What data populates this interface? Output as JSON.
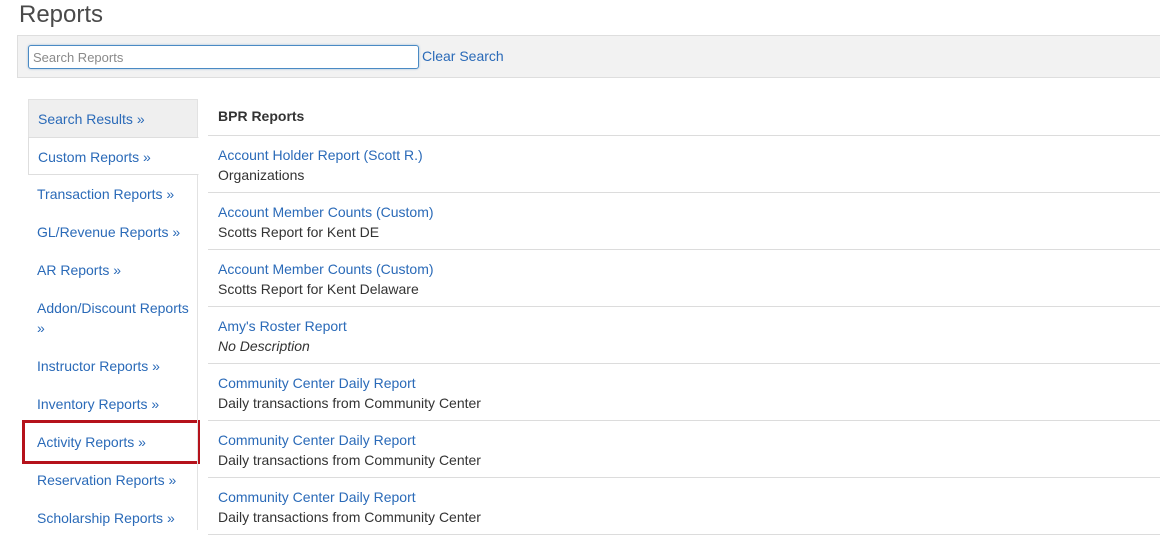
{
  "page": {
    "title": "Reports"
  },
  "search": {
    "placeholder": "Search Reports",
    "value": "",
    "clear_label": "Clear Search"
  },
  "sidebar": {
    "items": [
      {
        "label": "Search Results »"
      },
      {
        "label": "Custom Reports »"
      },
      {
        "label": "Transaction Reports »"
      },
      {
        "label": "GL/Revenue Reports »"
      },
      {
        "label": "AR Reports »"
      },
      {
        "label": "Addon/Discount Reports »"
      },
      {
        "label": "Instructor Reports »"
      },
      {
        "label": "Inventory Reports »"
      },
      {
        "label": "Activity Reports »"
      },
      {
        "label": "Reservation Reports »"
      },
      {
        "label": "Scholarship Reports »"
      }
    ]
  },
  "main": {
    "heading": "BPR Reports",
    "reports": [
      {
        "name": "Account Holder Report (Scott R.)",
        "description": "Organizations"
      },
      {
        "name": "Account Member Counts (Custom)",
        "description": "Scotts Report for Kent DE"
      },
      {
        "name": "Account Member Counts (Custom)",
        "description": "Scotts Report for Kent Delaware"
      },
      {
        "name": "Amy's Roster Report",
        "description": "No Description"
      },
      {
        "name": "Community Center Daily Report",
        "description": "Daily transactions from Community Center"
      },
      {
        "name": "Community Center Daily Report",
        "description": "Daily transactions from Community Center"
      },
      {
        "name": "Community Center Daily Report",
        "description": "Daily transactions from Community Center"
      }
    ]
  },
  "colors": {
    "link": "#2a6ab8",
    "highlight_border": "#b5121b",
    "search_bar_bg": "#f2f2f2"
  }
}
